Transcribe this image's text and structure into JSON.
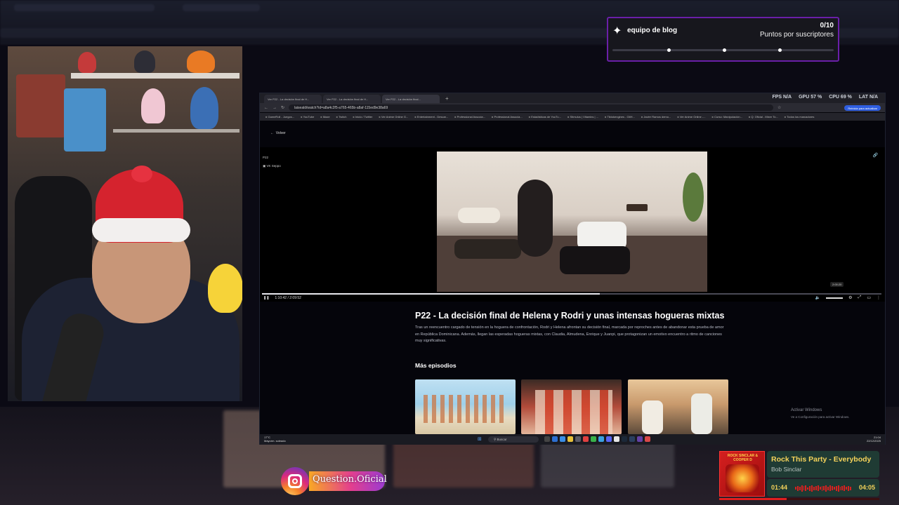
{
  "browser": {
    "tabs": [
      "Ver P22 - La decisión final de H...",
      "Ver P22 - La decisión final de H...",
      "Ver P22 - La decisión final..."
    ],
    "perf": {
      "fps_label": "FPS",
      "fps": "N/A",
      "gpu_label": "GPU",
      "gpu": "57 %",
      "cpu_label": "CPU",
      "cpu": "69 %",
      "lat_label": "LAT",
      "lat": "N/A"
    },
    "url": "laiseald/watch?id=a8a4c2f5-a765-465b-a8af-115ed9e38a69",
    "update_button": "Reinicia para actualizar",
    "bookmarks": [
      "GameRoll - Juegos...",
      "YouTube",
      "Maze",
      "Twitch",
      "Inicio / Twitter",
      "Ver Anime Online G...",
      "Entertainment - Descar...",
      "Professional Associa...",
      "Professional Associa...",
      "Estadísticas de YouTu...",
      "Stimulus | Vitamins | ...",
      "Tiktokengines - GitH...",
      "Javier Ramos demo...",
      "Ver Anime Online -...",
      "Curso: Manipulación...",
      "Q: Oficial - Mixer To..."
    ],
    "bookmarks_other": "Todos los marcadores"
  },
  "page": {
    "back_label": "Volver",
    "player": {
      "code": "P22",
      "source": "VK Seppo",
      "time_current": "1:10:42",
      "time_total": "2:09:52",
      "tooltip_time": "2:00:20",
      "progress": 0.545
    },
    "episode_title": "P22 - La decisión final de Helena y Rodri y unas intensas hogueras mixtas",
    "episode_description": "Tras un reencuentro cargado de tensión en la hoguera de confrontación, Rodri y Helena afrontan su decisión final, marcada por reproches antes de abandonar esta prueba de amor en República Dominicana. Además, llegan las esperadas hogueras mixtas, con Claudia, Almudena, Enrique y Juanpi, que protagonizan un emotivo encuentro a ritmo de canciones muy significativas.",
    "more_episodes_title": "Más episodios",
    "activate_title": "Activar Windows",
    "activate_sub": "Ve a Configuración para activar Windows."
  },
  "taskbar": {
    "weather_temp": "17°C",
    "weather_desc": "Mayorm. soleado",
    "search_placeholder": "Buscar",
    "time": "21:04",
    "date": "22/12/2025"
  },
  "goal": {
    "name": "equipo de blog",
    "count": "0/10",
    "label": "Puntos por suscriptores",
    "progress": 0
  },
  "instagram": {
    "handle": "Question.Oficial"
  },
  "now_playing": {
    "title": "Rock This Party - Everybody",
    "artist": "Bob Sinclar",
    "cover_text": "ROCK SINCLAR & COOPER D",
    "elapsed": "01:44",
    "total": "04:05",
    "progress": 0.42
  },
  "colors": {
    "goal_border": "#6a1fa8",
    "now_playing_accent": "#f4d25a",
    "now_playing_bg": "#1f3b34"
  }
}
